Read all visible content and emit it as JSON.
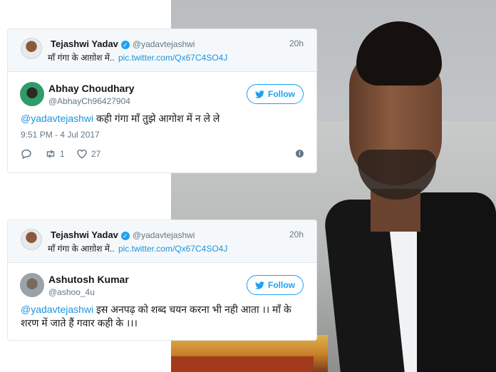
{
  "tweet1": {
    "quoted": {
      "name": "Tejashwi Yadav",
      "handle": "@yadavtejashwi",
      "time": "20h",
      "text": "माँ गंगा के आग़ोश में..",
      "link": "pic.twitter.com/Qx67C4SO4J"
    },
    "author": {
      "name": "Abhay Choudhary",
      "handle": "@AbhayCh96427904",
      "follow_label": "Follow"
    },
    "mention": "@yadavtejashwi",
    "text": " कही गंगा माँ तुझे आगोश में न ले ले",
    "timestamp": "9:51 PM - 4 Jul 2017",
    "retweets": "1",
    "likes": "27"
  },
  "tweet2": {
    "quoted": {
      "name": "Tejashwi Yadav",
      "handle": "@yadavtejashwi",
      "time": "20h",
      "text": "माँ गंगा के आग़ोश में..",
      "link": "pic.twitter.com/Qx67C4SO4J"
    },
    "author": {
      "name": "Ashutosh Kumar",
      "handle": "@ashoo_4u",
      "follow_label": "Follow"
    },
    "mention": "@yadavtejashwi",
    "text": " इस अनपढ़ को शब्द चयन करना भी नही आता ।। माँ के शरण में जाते हैं गवार कही के ।।।"
  },
  "colors": {
    "twitter_blue": "#1da1f2",
    "link_blue": "#1b95e0",
    "muted_gray": "#657786"
  },
  "icons": [
    "verified-icon",
    "twitter-bird-icon",
    "reply-icon",
    "retweet-icon",
    "heart-icon",
    "info-icon"
  ]
}
